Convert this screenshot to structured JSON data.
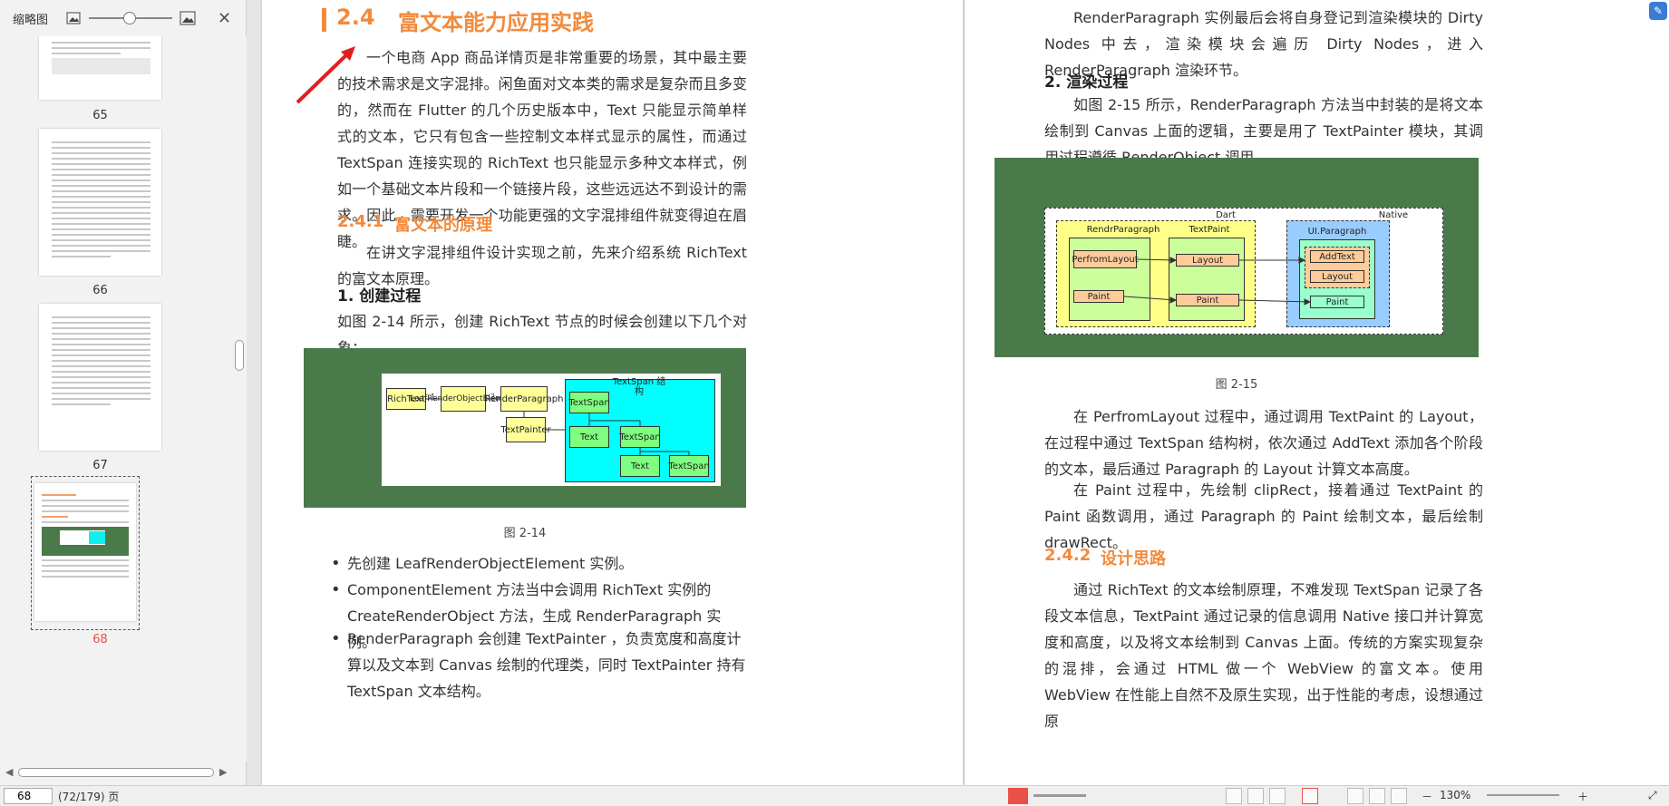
{
  "sidebar": {
    "title": "缩略图",
    "pages": [
      {
        "label": "65"
      },
      {
        "label": "66"
      },
      {
        "label": "67"
      },
      {
        "label": "68"
      }
    ]
  },
  "left_page": {
    "section_number": "2.4",
    "section_title": "富文本能力应用实践",
    "intro": "一个电商 App 商品详情页是非常重要的场景，其中最主要的技术需求是文字混排。闲鱼面对文本类的需求是复杂而且多变的，然而在 Flutter 的几个历史版本中，Text 只能显示简单样式的文本，它只有包含一些控制文本样式显示的属性，而通过 TextSpan 连接实现的 RichText 也只能显示多种文本样式，例如一个基础文本片段和一个链接片段，这些远远达不到设计的需求。因此，需要开发一个功能更强的文字混排组件就变得迫在眉睫。",
    "sub_number": "2.4.1",
    "sub_title": "富文本的原理",
    "sub_para": "在讲文字混排组件设计实现之前，先来介绍系统 RichText 的富文本原理。",
    "h_create": "1. 创建过程",
    "create_para": "如图 2-14 所示，创建 RichText 节点的时候会创建以下几个对象：",
    "fig14": {
      "richtext": "RichText",
      "leaf": "LeafRenderObjectElement",
      "render_paragraph": "RenderParagraph",
      "text_painter": "TextPainter",
      "span_title": "TextSpan 结构",
      "textspan_root": "TextSpan",
      "text1": "Text",
      "textspan2": "TextSpan",
      "text2": "Text",
      "textspan3": "TextSpan",
      "n1": "1",
      "n2": "2"
    },
    "caption14": "图 2-14",
    "bullets": [
      "先创建 LeafRenderObjectElement 实例。",
      "ComponentElement 方法当中会调用 RichText 实例的 CreateRenderObject 方法，生成 RenderParagraph 实例。",
      "RenderParagraph 会创建 TextPainter ，负责宽度和高度计算以及文本到 Canvas 绘制的代理类，同时 TextPainter 持有 TextSpan 文本结构。"
    ]
  },
  "right_page": {
    "top_para": "RenderParagraph 实例最后会将自身登记到渲染模块的 Dirty Nodes 中去，渲染模块会遍历 Dirty Nodes，进入 RenderParagraph 渲染环节。",
    "h_render": "2. 渲染过程",
    "render_para": "如图 2-15 所示，RenderParagraph 方法当中封装的是将文本绘制到 Canvas 上面的逻辑，主要是用了 TextPainter 模块，其调用过程遵循 RenderObject 调用。",
    "fig15": {
      "dart": "Dart",
      "native": "Native",
      "render_paragraph": "RendrParagraph",
      "perform_layout": "PerfromLayout",
      "paint_left": "Paint",
      "textpaint": "TextPaint",
      "layout_mid": "Layout",
      "paint_mid": "Paint",
      "ui_paragraph": "UI.Paragraph",
      "addtext": "AddText",
      "layout_right": "Layout",
      "paint_right": "Paint"
    },
    "caption15": "图 2-15",
    "para_layout": "在 PerfromLayout 过程中，通过调用 TextPaint 的 Layout，在过程中通过 TextSpan 结构树，依次通过 AddText 添加各个阶段的文本，最后通过 Paragraph 的 Layout 计算文本高度。",
    "para_paint": "在 Paint 过程中，先绘制 clipRect，接着通过 TextPaint 的 Paint 函数调用，通过 Paragraph 的 Paint 绘制文本，最后绘制 drawRect。",
    "sub_number": "2.4.2",
    "sub_title": "设计思路",
    "design_para": "通过 RichText 的文本绘制原理，不难发现 TextSpan 记录了各段文本信息，TextPaint 通过记录的信息调用 Native 接口并计算宽度和高度，以及将文本绘制到 Canvas 上面。传统的方案实现复杂的混排，会通过 HTML 做一个 WebView 的富文本。使用 WebView 在性能上自然不及原生实现，出于性能的考虑，设想通过原"
  },
  "bottom": {
    "page_value": "68",
    "page_total": "(72/179) 页",
    "zoom": "130%"
  },
  "colors": {
    "accent_orange": "#f28a3c",
    "diagram_green": "#4a7a4a",
    "arrow_red": "#e02020"
  }
}
